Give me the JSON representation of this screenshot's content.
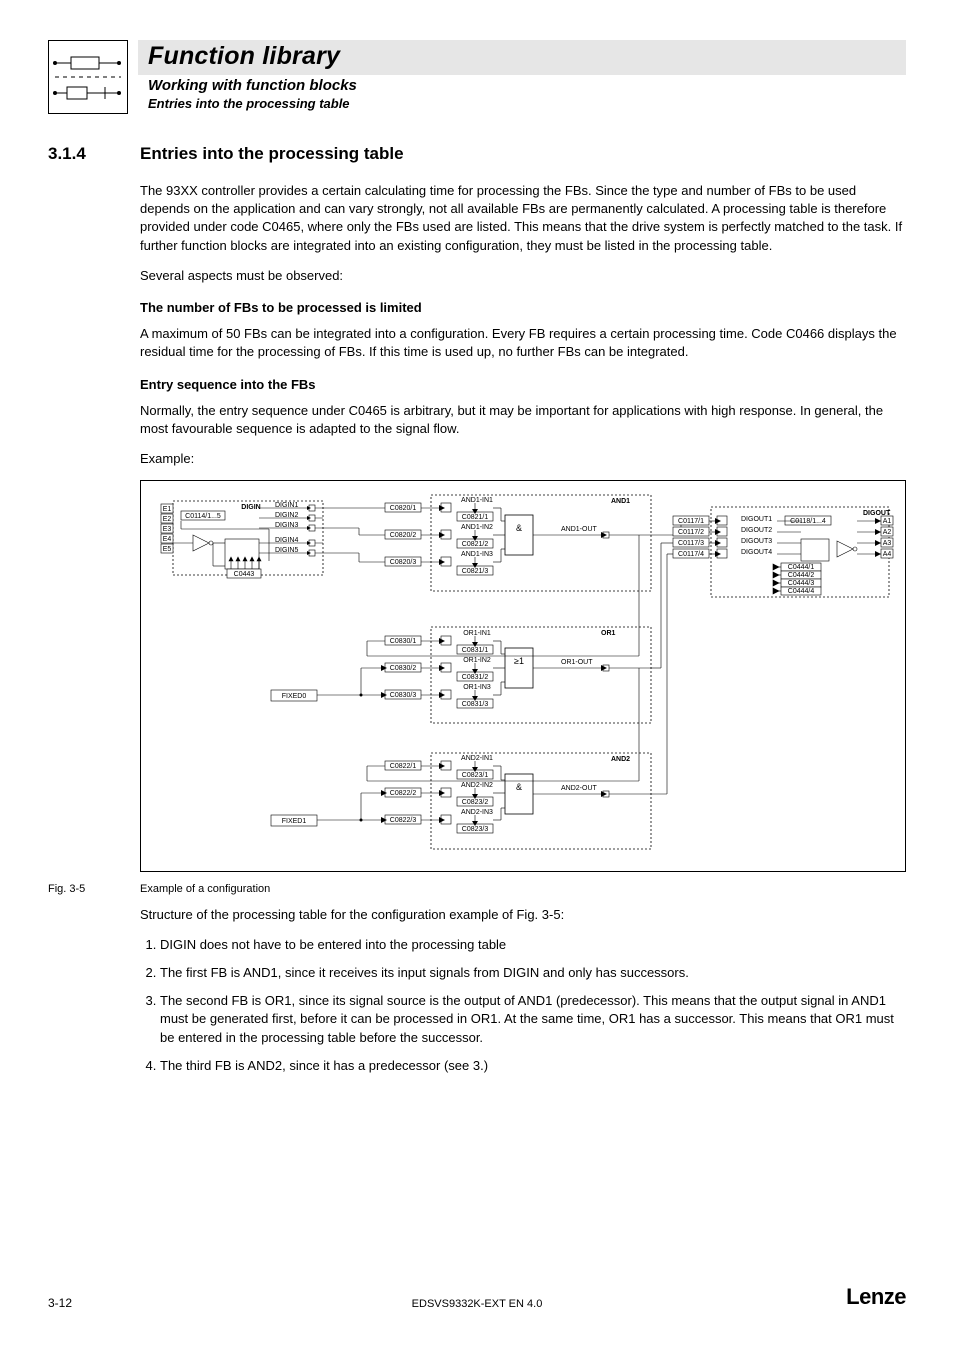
{
  "header": {
    "title": "Function library",
    "subtitle": "Working with function blocks",
    "subsubtitle": "Entries into the processing table"
  },
  "section": {
    "number": "3.1.4",
    "title": "Entries into the processing table"
  },
  "paragraphs": {
    "intro": "The 93XX controller provides a certain calculating time for processing the FBs. Since the type and number of FBs to be used depends on the application and can vary strongly, not all available FBs are permanently calculated. A processing table is therefore provided under code C0465, where only the FBs used are listed. This means that the drive system is perfectly matched to the task. If further function blocks are integrated into an existing configuration, they must be listed in the processing table.",
    "aspects": "Several aspects must be observed:",
    "h_num": "The number of FBs to be processed is limited",
    "p_num": "A maximum of 50 FBs can be integrated into a configuration. Every FB requires a certain processing time.  Code C0466 displays the residual time for the processing of FBs. If this time is used up, no further FBs can be integrated.",
    "h_seq": "Entry sequence into the FBs",
    "p_seq": "Normally, the entry sequence under C0465 is arbitrary, but it may be important for applications with high response. In general, the most favourable sequence is adapted to the signal flow.",
    "example_label": "Example:",
    "fig_label": "Fig. 3-5",
    "fig_caption": "Example of a configuration",
    "struct_line": "Structure of the processing table for the configuration example of Fig. 3-5:"
  },
  "list": [
    "DIGIN does not have to be entered into the processing table",
    "The first FB is AND1, since it receives its input signals from DIGIN and only has successors.",
    "The second FB is OR1, since its signal source is the output of AND1 (predecessor).  This means that the output signal in AND1 must be generated first, before it can be processed in OR1. At the same time, OR1 has a successor. This means that OR1 must be entered in the processing table before the successor.",
    "The third FB is AND2, since it has a predecessor (see 3.)"
  ],
  "footer": {
    "page_number": "3-12",
    "doc_id": "EDSVS9332K-EXT EN 4.0",
    "brand": "Lenze"
  },
  "diagram": {
    "digin": {
      "title": "DIGIN",
      "inputs": [
        "E1",
        "E2",
        "E3",
        "E4",
        "E5"
      ],
      "code_left": "C0114/1...5",
      "code_bottom": "C0443",
      "outputs": [
        "DIGIN1",
        "DIGIN2",
        "DIGIN3",
        "DIGIN4",
        "DIGIN5"
      ]
    },
    "and1": {
      "title": "AND1",
      "ports": [
        "AND1-IN1",
        "AND1-IN2",
        "AND1-IN3",
        "AND1-OUT"
      ],
      "port_codes_in": [
        "C0820/1",
        "C0820/2",
        "C0820/3"
      ],
      "port_codes_cfg": [
        "C0821/1",
        "C0821/2",
        "C0821/3"
      ],
      "op": "&"
    },
    "or1": {
      "title": "OR1",
      "ports": [
        "OR1-IN1",
        "OR1-IN2",
        "OR1-IN3",
        "OR1-OUT"
      ],
      "port_codes_in": [
        "C0830/1",
        "C0830/2",
        "C0830/3"
      ],
      "port_codes_cfg": [
        "C0831/1",
        "C0831/2",
        "C0831/3"
      ],
      "op": "≥1"
    },
    "and2": {
      "title": "AND2",
      "ports": [
        "AND2-IN1",
        "AND2-IN2",
        "AND2-IN3",
        "AND2-OUT"
      ],
      "port_codes_in": [
        "C0822/1",
        "C0822/2",
        "C0822/3"
      ],
      "port_codes_cfg": [
        "C0823/1",
        "C0823/2",
        "C0823/3"
      ],
      "op": "&"
    },
    "digout": {
      "title": "DIGOUT",
      "outputs": [
        "DIGOUT1",
        "DIGOUT2",
        "DIGOUT3",
        "DIGOUT4"
      ],
      "port_codes_in": [
        "C0117/1",
        "C0117/2",
        "C0117/3",
        "C0117/4"
      ],
      "code_right_top": "C0118/1...4",
      "cfg_codes": [
        "C0444/1",
        "C0444/2",
        "C0444/3",
        "C0444/4"
      ],
      "terminals": [
        "A1",
        "A2",
        "A3",
        "A4"
      ]
    },
    "fixed": [
      "FIXED0",
      "FIXED1"
    ]
  }
}
